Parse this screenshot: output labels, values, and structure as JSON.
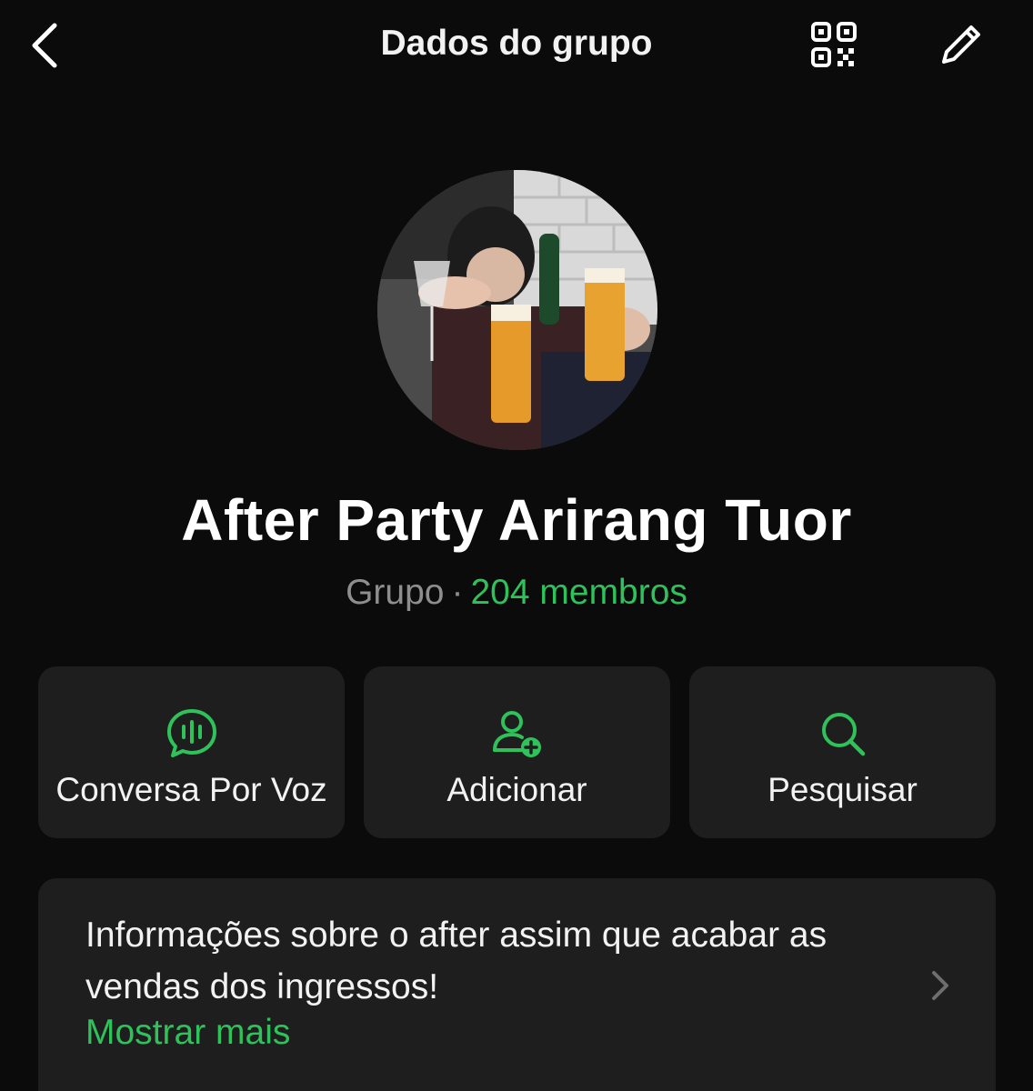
{
  "header": {
    "title": "Dados do grupo"
  },
  "group": {
    "name": "After Party Arirang Tuor",
    "kind": "Grupo",
    "separator": "·",
    "members": "204 membros"
  },
  "actions": [
    {
      "label": "Conversa Por Voz",
      "icon": "voice-chat-icon"
    },
    {
      "label": "Adicionar",
      "icon": "add-person-icon"
    },
    {
      "label": "Pesquisar",
      "icon": "search-icon"
    }
  ],
  "description": {
    "text": "Informações sobre o after assim que acabar as vendas dos ingressos!",
    "show_more": "Mostrar mais"
  },
  "colors": {
    "background": "#0b0b0b",
    "card": "#1e1e1e",
    "accent": "#2fc15a",
    "muted": "#8e8e8e"
  }
}
